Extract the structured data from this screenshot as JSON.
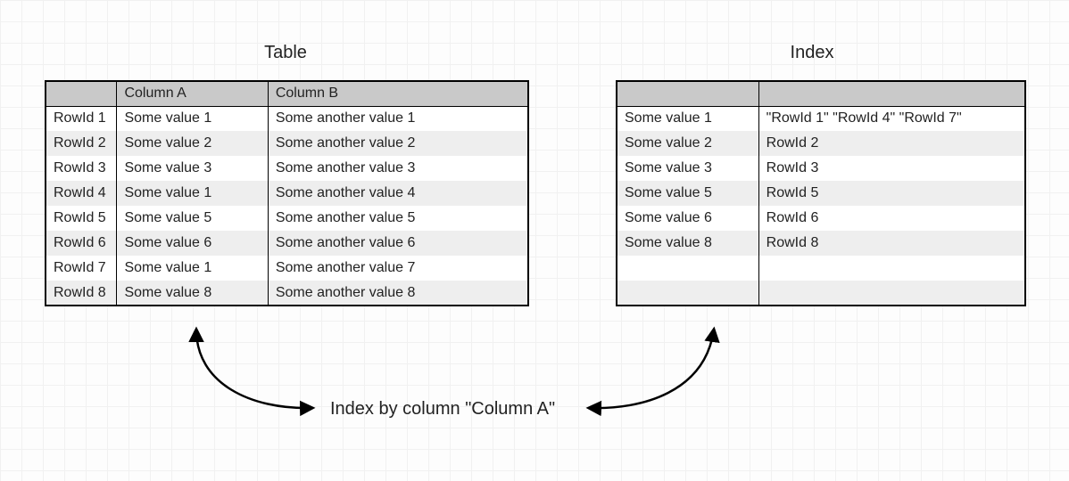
{
  "titles": {
    "left": "Table",
    "right": "Index"
  },
  "left_table": {
    "headers": [
      "",
      "Column A",
      "Column B"
    ],
    "rows": [
      {
        "rowid": "RowId 1",
        "colA": "Some value 1",
        "colB": "Some another value 1"
      },
      {
        "rowid": "RowId 2",
        "colA": "Some value 2",
        "colB": "Some another value 2"
      },
      {
        "rowid": "RowId 3",
        "colA": "Some value 3",
        "colB": "Some another value 3"
      },
      {
        "rowid": "RowId 4",
        "colA": "Some value 1",
        "colB": "Some another value 4"
      },
      {
        "rowid": "RowId 5",
        "colA": "Some value 5",
        "colB": "Some another value 5"
      },
      {
        "rowid": "RowId 6",
        "colA": "Some value 6",
        "colB": "Some another value 6"
      },
      {
        "rowid": "RowId 7",
        "colA": "Some value 1",
        "colB": "Some another value 7"
      },
      {
        "rowid": "RowId 8",
        "colA": "Some value 8",
        "colB": "Some another value 8"
      }
    ]
  },
  "right_table": {
    "headers": [
      "",
      ""
    ],
    "rows": [
      {
        "key": "Some value 1",
        "ptr": "\"RowId 1\" \"RowId 4\" \"RowId 7\""
      },
      {
        "key": "Some value 2",
        "ptr": "RowId 2"
      },
      {
        "key": "Some value 3",
        "ptr": "RowId 3"
      },
      {
        "key": "Some value 5",
        "ptr": "RowId 5"
      },
      {
        "key": "Some value 6",
        "ptr": "RowId 6"
      },
      {
        "key": "Some value 8",
        "ptr": "RowId 8"
      },
      {
        "key": " ",
        "ptr": " "
      },
      {
        "key": " ",
        "ptr": " "
      }
    ]
  },
  "caption": "Index by column \"Column A\""
}
